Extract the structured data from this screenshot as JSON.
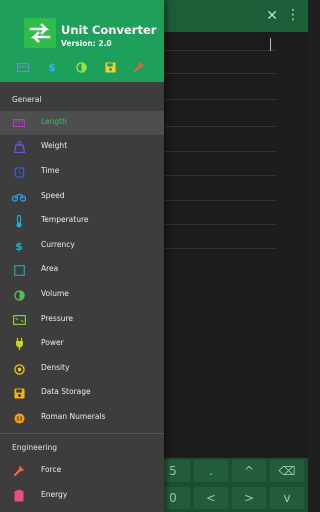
{
  "app": {
    "title": "Unit Converter",
    "version": "Version: 2.0"
  },
  "colors": {
    "header": "#1fa05a",
    "drawer": "#3d3d3d",
    "accent": "#25c86d",
    "toolbar_bg": "#1b5e38"
  },
  "quick_actions": [
    {
      "name": "calculator-icon",
      "color": "#7d7ff3"
    },
    {
      "name": "currency-icon",
      "color": "#35b5f2"
    },
    {
      "name": "theme-icon",
      "color": "#9be23b"
    },
    {
      "name": "save-icon",
      "color": "#f6d22b"
    },
    {
      "name": "wrench-icon",
      "color": "#f05f3c"
    }
  ],
  "toolbar": {
    "close_icon": "close-icon",
    "more_icon": "more-icon"
  },
  "sections": {
    "general": "General",
    "engineering": "Engineering"
  },
  "general_items": [
    {
      "label": "Length",
      "icon": "ruler-icon",
      "color": "#ad3fbf",
      "selected": true
    },
    {
      "label": "Weight",
      "icon": "weight-icon",
      "color": "#6a5bd8"
    },
    {
      "label": "Time",
      "icon": "clock-icon",
      "color": "#3b63d3"
    },
    {
      "label": "Speed",
      "icon": "motorbike-icon",
      "color": "#2d9ff0"
    },
    {
      "label": "Temperature",
      "icon": "thermometer-icon",
      "color": "#1fb1d6"
    },
    {
      "label": "Currency",
      "icon": "dollar-icon",
      "color": "#17b4d0"
    },
    {
      "label": "Area",
      "icon": "area-icon",
      "color": "#1f9f9a"
    },
    {
      "label": "Volume",
      "icon": "volume-icon",
      "color": "#5cb85c"
    },
    {
      "label": "Pressure",
      "icon": "pressure-icon",
      "color": "#8cc63f"
    },
    {
      "label": "Power",
      "icon": "plug-icon",
      "color": "#c8d41f"
    },
    {
      "label": "Density",
      "icon": "density-icon",
      "color": "#f0c419"
    },
    {
      "label": "Data Storage",
      "icon": "storage-icon",
      "color": "#f5b400"
    },
    {
      "label": "Roman Numerals",
      "icon": "roman-icon",
      "color": "#f39c12"
    }
  ],
  "engineering_items": [
    {
      "label": "Force",
      "icon": "force-icon",
      "color": "#f26b3a"
    },
    {
      "label": "Energy",
      "icon": "energy-icon",
      "color": "#e84c8b"
    }
  ],
  "keypad": {
    "row1": [
      "5",
      ".",
      "^",
      "⌫"
    ],
    "row2": [
      "0",
      "<",
      ">",
      "v"
    ]
  }
}
